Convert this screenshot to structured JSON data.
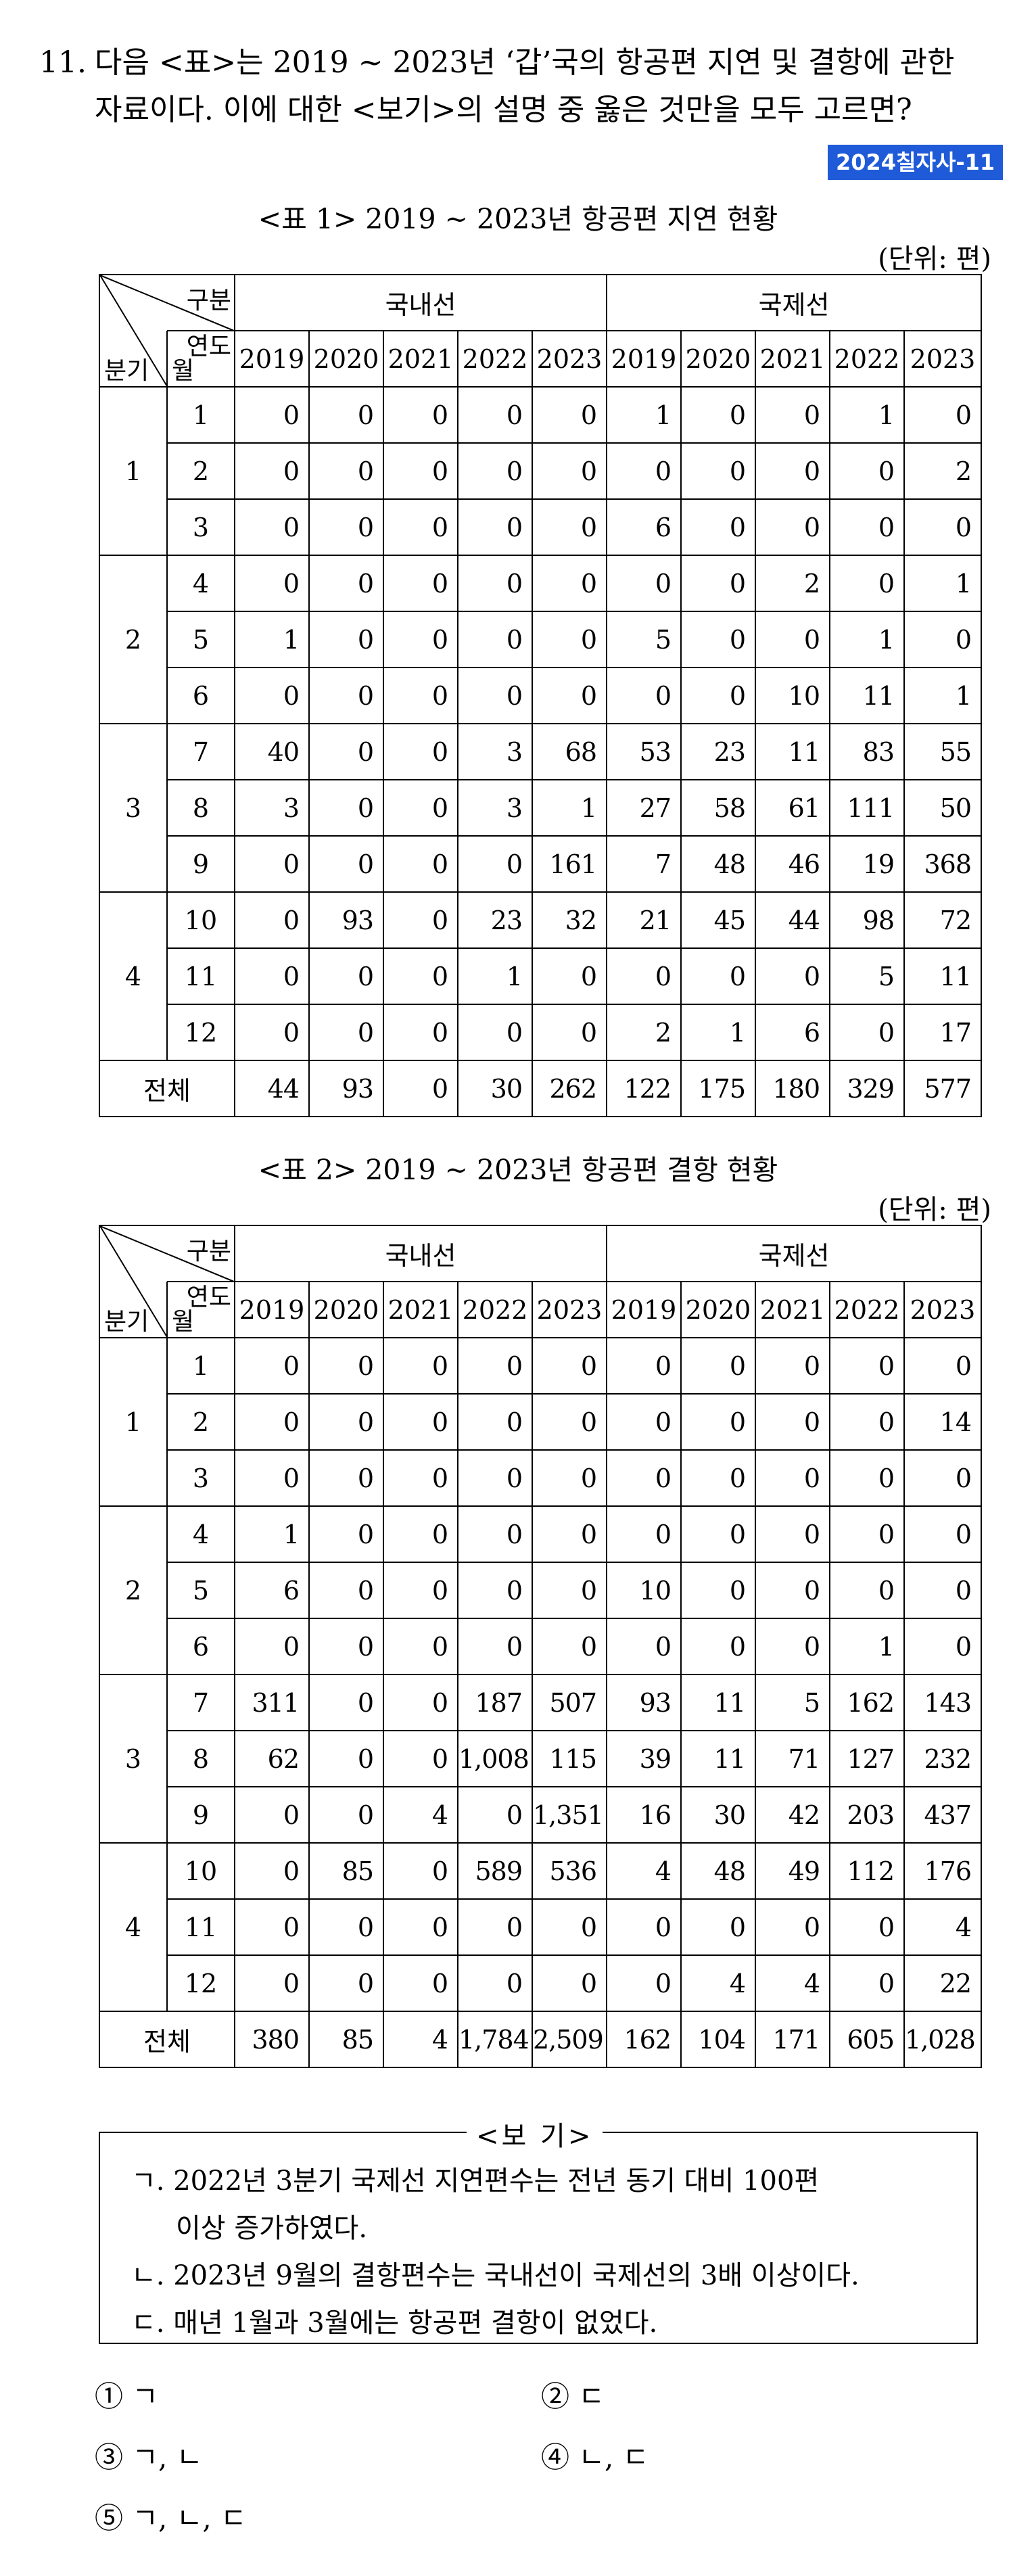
{
  "question": {
    "number": "11.",
    "line1": "다음 <표>는 2019 ~ 2023년 ‘갑’국의 항공편 지연 및 결항에 관한",
    "line2": "자료이다. 이에 대한 <보기>의 설명 중 옳은 것만을 모두 고르면?",
    "source_badge": "2024칠자사-11"
  },
  "tables": [
    {
      "caption": "<표 1> 2019 ~ 2023년 항공편 지연 현황",
      "unit": "(단위: 편)",
      "header": {
        "category_label": "구분",
        "year_label": "연도",
        "month_label": "월",
        "quarter_label": "분기",
        "group_domestic": "국내선",
        "group_international": "국제선",
        "years": [
          "2019",
          "2020",
          "2021",
          "2022",
          "2023"
        ]
      },
      "rows": [
        {
          "quarter": "1",
          "month": "1",
          "domestic": [
            "0",
            "0",
            "0",
            "0",
            "0"
          ],
          "international": [
            "1",
            "0",
            "0",
            "1",
            "0"
          ]
        },
        {
          "quarter": "1",
          "month": "2",
          "domestic": [
            "0",
            "0",
            "0",
            "0",
            "0"
          ],
          "international": [
            "0",
            "0",
            "0",
            "0",
            "2"
          ]
        },
        {
          "quarter": "1",
          "month": "3",
          "domestic": [
            "0",
            "0",
            "0",
            "0",
            "0"
          ],
          "international": [
            "6",
            "0",
            "0",
            "0",
            "0"
          ]
        },
        {
          "quarter": "2",
          "month": "4",
          "domestic": [
            "0",
            "0",
            "0",
            "0",
            "0"
          ],
          "international": [
            "0",
            "0",
            "2",
            "0",
            "1"
          ]
        },
        {
          "quarter": "2",
          "month": "5",
          "domestic": [
            "1",
            "0",
            "0",
            "0",
            "0"
          ],
          "international": [
            "5",
            "0",
            "0",
            "1",
            "0"
          ]
        },
        {
          "quarter": "2",
          "month": "6",
          "domestic": [
            "0",
            "0",
            "0",
            "0",
            "0"
          ],
          "international": [
            "0",
            "0",
            "10",
            "11",
            "1"
          ]
        },
        {
          "quarter": "3",
          "month": "7",
          "domestic": [
            "40",
            "0",
            "0",
            "3",
            "68"
          ],
          "international": [
            "53",
            "23",
            "11",
            "83",
            "55"
          ]
        },
        {
          "quarter": "3",
          "month": "8",
          "domestic": [
            "3",
            "0",
            "0",
            "3",
            "1"
          ],
          "international": [
            "27",
            "58",
            "61",
            "111",
            "50"
          ]
        },
        {
          "quarter": "3",
          "month": "9",
          "domestic": [
            "0",
            "0",
            "0",
            "0",
            "161"
          ],
          "international": [
            "7",
            "48",
            "46",
            "19",
            "368"
          ]
        },
        {
          "quarter": "4",
          "month": "10",
          "domestic": [
            "0",
            "93",
            "0",
            "23",
            "32"
          ],
          "international": [
            "21",
            "45",
            "44",
            "98",
            "72"
          ]
        },
        {
          "quarter": "4",
          "month": "11",
          "domestic": [
            "0",
            "0",
            "0",
            "1",
            "0"
          ],
          "international": [
            "0",
            "0",
            "0",
            "5",
            "11"
          ]
        },
        {
          "quarter": "4",
          "month": "12",
          "domestic": [
            "0",
            "0",
            "0",
            "0",
            "0"
          ],
          "international": [
            "2",
            "1",
            "6",
            "0",
            "17"
          ]
        }
      ],
      "total": {
        "label": "전체",
        "domestic": [
          "44",
          "93",
          "0",
          "30",
          "262"
        ],
        "international": [
          "122",
          "175",
          "180",
          "329",
          "577"
        ]
      }
    },
    {
      "caption": "<표 2> 2019 ~ 2023년 항공편 결항 현황",
      "unit": "(단위: 편)",
      "header": {
        "category_label": "구분",
        "year_label": "연도",
        "month_label": "월",
        "quarter_label": "분기",
        "group_domestic": "국내선",
        "group_international": "국제선",
        "years": [
          "2019",
          "2020",
          "2021",
          "2022",
          "2023"
        ]
      },
      "rows": [
        {
          "quarter": "1",
          "month": "1",
          "domestic": [
            "0",
            "0",
            "0",
            "0",
            "0"
          ],
          "international": [
            "0",
            "0",
            "0",
            "0",
            "0"
          ]
        },
        {
          "quarter": "1",
          "month": "2",
          "domestic": [
            "0",
            "0",
            "0",
            "0",
            "0"
          ],
          "international": [
            "0",
            "0",
            "0",
            "0",
            "14"
          ]
        },
        {
          "quarter": "1",
          "month": "3",
          "domestic": [
            "0",
            "0",
            "0",
            "0",
            "0"
          ],
          "international": [
            "0",
            "0",
            "0",
            "0",
            "0"
          ]
        },
        {
          "quarter": "2",
          "month": "4",
          "domestic": [
            "1",
            "0",
            "0",
            "0",
            "0"
          ],
          "international": [
            "0",
            "0",
            "0",
            "0",
            "0"
          ]
        },
        {
          "quarter": "2",
          "month": "5",
          "domestic": [
            "6",
            "0",
            "0",
            "0",
            "0"
          ],
          "international": [
            "10",
            "0",
            "0",
            "0",
            "0"
          ]
        },
        {
          "quarter": "2",
          "month": "6",
          "domestic": [
            "0",
            "0",
            "0",
            "0",
            "0"
          ],
          "international": [
            "0",
            "0",
            "0",
            "1",
            "0"
          ]
        },
        {
          "quarter": "3",
          "month": "7",
          "domestic": [
            "311",
            "0",
            "0",
            "187",
            "507"
          ],
          "international": [
            "93",
            "11",
            "5",
            "162",
            "143"
          ]
        },
        {
          "quarter": "3",
          "month": "8",
          "domestic": [
            "62",
            "0",
            "0",
            "1,008",
            "115"
          ],
          "international": [
            "39",
            "11",
            "71",
            "127",
            "232"
          ]
        },
        {
          "quarter": "3",
          "month": "9",
          "domestic": [
            "0",
            "0",
            "4",
            "0",
            "1,351"
          ],
          "international": [
            "16",
            "30",
            "42",
            "203",
            "437"
          ]
        },
        {
          "quarter": "4",
          "month": "10",
          "domestic": [
            "0",
            "85",
            "0",
            "589",
            "536"
          ],
          "international": [
            "4",
            "48",
            "49",
            "112",
            "176"
          ]
        },
        {
          "quarter": "4",
          "month": "11",
          "domestic": [
            "0",
            "0",
            "0",
            "0",
            "0"
          ],
          "international": [
            "0",
            "0",
            "0",
            "0",
            "4"
          ]
        },
        {
          "quarter": "4",
          "month": "12",
          "domestic": [
            "0",
            "0",
            "0",
            "0",
            "0"
          ],
          "international": [
            "0",
            "4",
            "4",
            "0",
            "22"
          ]
        }
      ],
      "total": {
        "label": "전체",
        "domestic": [
          "380",
          "85",
          "4",
          "1,784",
          "2,509"
        ],
        "international": [
          "162",
          "104",
          "171",
          "605",
          "1,028"
        ]
      }
    }
  ],
  "bogi": {
    "title": "<보 기>",
    "items": [
      {
        "line1": "ㄱ. 2022년 3분기 국제선 지연편수는 전년 동기 대비 100편",
        "line2": "이상 증가하였다."
      },
      {
        "line1": "ㄴ. 2023년 9월의 결항편수는 국내선이 국제선의 3배 이상이다.",
        "line2": ""
      },
      {
        "line1": "ㄷ. 매년 1월과 3월에는 항공편 결항이 없었다.",
        "line2": ""
      }
    ]
  },
  "choices": [
    "① ㄱ",
    "② ㄷ",
    "③ ㄱ, ㄴ",
    "④ ㄴ, ㄷ",
    "⑤ ㄱ, ㄴ, ㄷ"
  ]
}
